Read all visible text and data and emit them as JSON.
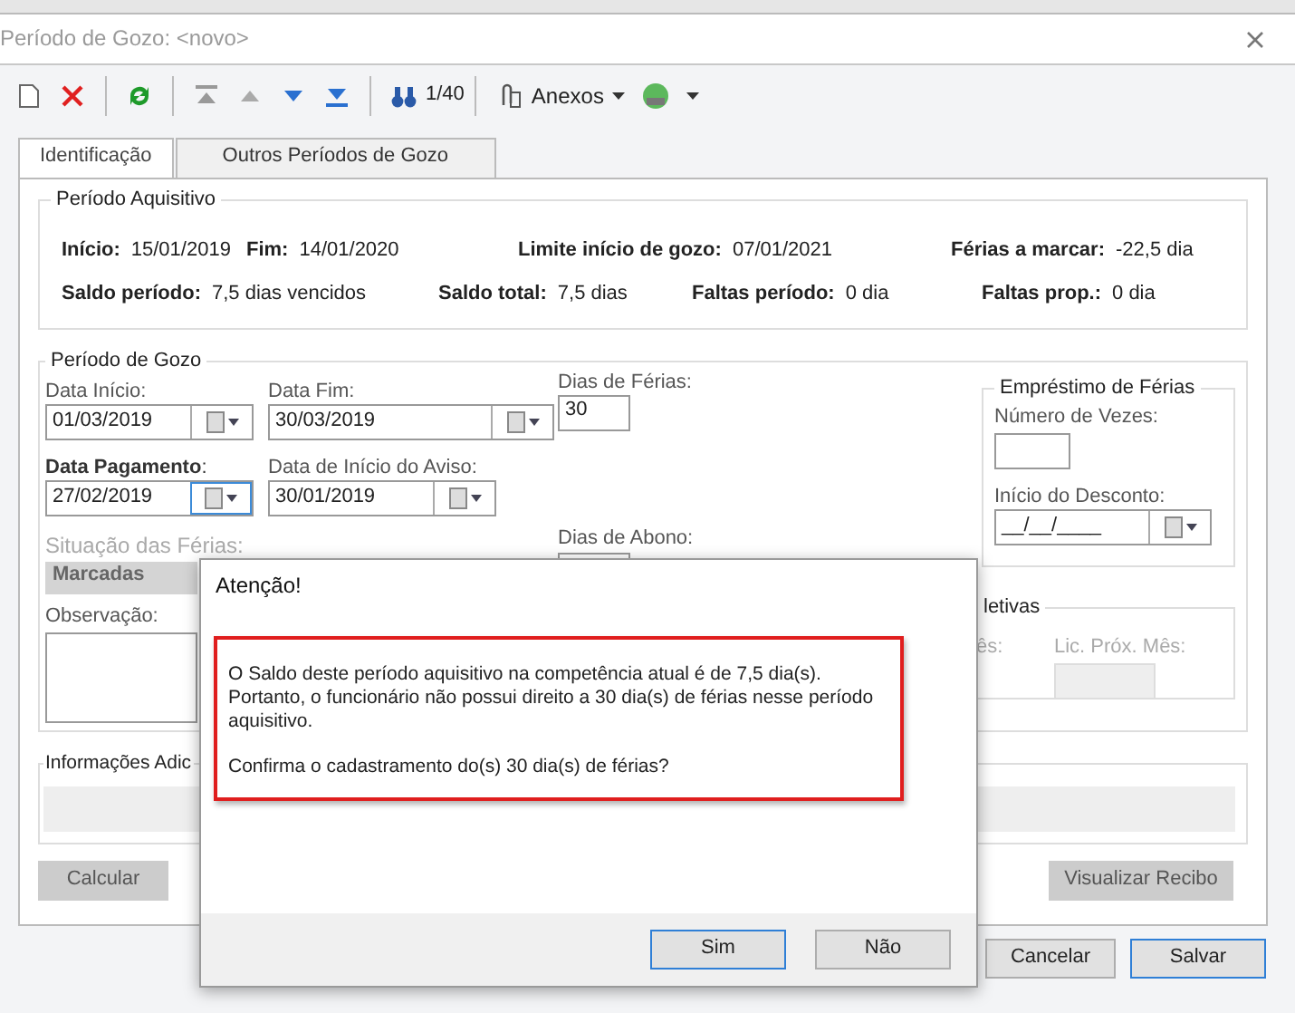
{
  "window": {
    "title": "Período de Gozo: <novo>"
  },
  "toolbar": {
    "record_counter": "1/40",
    "attachments_label": "Anexos"
  },
  "tabs": [
    {
      "label": "Identificação",
      "selected": true
    },
    {
      "label": "Outros Períodos de Gozo",
      "selected": false
    }
  ],
  "periodo_aquisitivo": {
    "title": "Período Aquisitivo",
    "rows": [
      {
        "fields": [
          {
            "label": "Início:",
            "value": "15/01/2019"
          },
          {
            "label": "Fim:",
            "value": "14/01/2020"
          },
          {
            "label": "Limite início de gozo:",
            "value": "07/01/2021"
          },
          {
            "label": "Férias a marcar:",
            "value": "-22,5  dia"
          }
        ]
      },
      {
        "fields": [
          {
            "label": "Saldo período:",
            "value": "7,5 dias vencidos"
          },
          {
            "label": "Saldo total:",
            "value": "7,5  dias"
          },
          {
            "label": "Faltas período:",
            "value": "0  dia"
          },
          {
            "label": "Faltas prop.:",
            "value": "0  dia"
          }
        ]
      }
    ]
  },
  "periodo_gozo": {
    "title": "Período de Gozo",
    "data_inicio": {
      "label": "Data Início:",
      "value": "01/03/2019"
    },
    "data_fim": {
      "label": "Data Fim:",
      "value": "30/03/2019"
    },
    "data_pagamento": {
      "label": "**Data Pagamento**:",
      "value": "27/02/2019",
      "focused": true
    },
    "data_aviso": {
      "label": "Data de Início do Aviso:",
      "value": "30/01/2019"
    },
    "dias_ferias": {
      "label": "Dias de Férias:",
      "value": "30"
    },
    "dias_abono": {
      "label": "Dias de Abono:"
    },
    "situacao": {
      "label": "Situação das Férias:",
      "value": "Marcadas",
      "disabled": true
    },
    "observacao": {
      "label": "Observação:"
    },
    "emprestimo": {
      "title": "Empréstimo de Férias",
      "numero_vezes_label": "Número de Vezes:",
      "inicio_desconto_label": "Início do Desconto:",
      "inicio_desconto_value": "__/__/____"
    },
    "coletivas": {
      "title": "letivas",
      "column_1_label": "ês:",
      "lic_prox_mes_label": "Lic. Próx. Mês:"
    }
  },
  "informacoes": {
    "title": "Informações Adic"
  },
  "actions": [
    {
      "label": "Calcular"
    },
    {
      "label": "Visualizar Recibo"
    }
  ],
  "footer_buttons": [
    {
      "label": "Cancelar",
      "default": false
    },
    {
      "label": "Salvar",
      "default": true
    }
  ],
  "dialog": {
    "title": "Atenção!",
    "message": [
      "O Saldo deste período aquisitivo na competência atual é de 7,5 dia(s). Portanto, o funcionário não possui direito a 30 dia(s) de férias nesse período aquisitivo.",
      "Confirma o cadastramento do(s) 30 dia(s) de férias?"
    ],
    "buttons": [
      {
        "label": "Sim",
        "default": true
      },
      {
        "label": "Não",
        "default": false
      }
    ]
  }
}
